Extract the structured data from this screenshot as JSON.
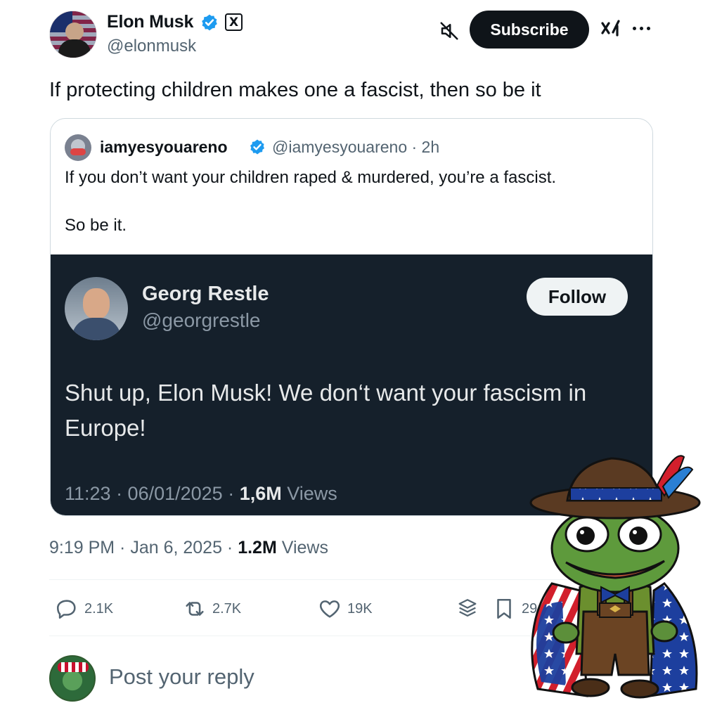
{
  "author": {
    "display_name": "Elon Musk",
    "handle": "@elonmusk",
    "badge": "X"
  },
  "header": {
    "subscribe_label": "Subscribe"
  },
  "tweet": {
    "text": "If protecting children makes one a fascist, then so be it"
  },
  "quote": {
    "display_name": "iamyesyouareno",
    "meta": "@iamyesyouareno · 2h",
    "line1": "If you don’t want your children raped & murdered, you’re a fascist.",
    "line2": "So be it."
  },
  "embedded": {
    "display_name": "Georg Restle",
    "handle": "@georgrestle",
    "follow_label": "Follow",
    "text": "Shut up, Elon Musk! We don‘t want your fascism in Europe!",
    "meta_prefix": "11:23 · 06/01/2025 · ",
    "views_count": "1,6M",
    "views_label": " Views"
  },
  "post_meta": {
    "timestamp": "9:19 PM · Jan 6, 2025 · ",
    "views_count": "1.2M",
    "views_label": " Views"
  },
  "actions": {
    "replies": "2.1K",
    "reposts": "2.7K",
    "likes": "19K",
    "bookmarks": "29"
  },
  "reply": {
    "placeholder": "Post your reply"
  },
  "colors": {
    "verified": "#1d9bf0",
    "embedded_bg": "#15202b",
    "muted_text": "#536471"
  }
}
